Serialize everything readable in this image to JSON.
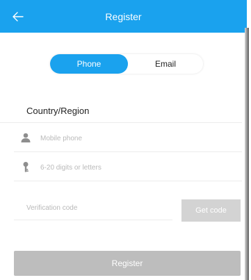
{
  "header": {
    "title": "Register",
    "back_icon": "arrow-left-icon",
    "background_color": "#1aa2ee"
  },
  "segmented": {
    "phone_label": "Phone",
    "email_label": "Email",
    "selected": "Phone",
    "accent_color": "#1aa2ee"
  },
  "form": {
    "country_label": "Country/Region",
    "mobile": {
      "placeholder": "Mobile phone",
      "value": "",
      "icon": "person-icon"
    },
    "password": {
      "placeholder": "6-20 digits or letters",
      "value": "",
      "icon": "key-icon"
    },
    "verification": {
      "placeholder": "Verification code",
      "value": ""
    },
    "get_code_label": "Get code"
  },
  "footer": {
    "register_label": "Register"
  }
}
